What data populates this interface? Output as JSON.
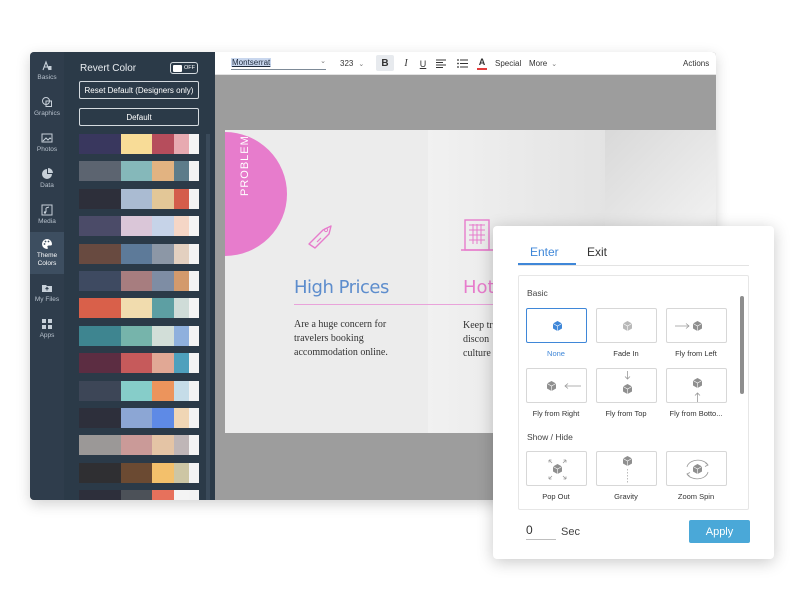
{
  "nav": {
    "items": [
      {
        "label": "Basics",
        "icon": "basics-icon"
      },
      {
        "label": "Graphics",
        "icon": "graphics-icon"
      },
      {
        "label": "Photos",
        "icon": "photos-icon"
      },
      {
        "label": "Data",
        "icon": "data-icon"
      },
      {
        "label": "Media",
        "icon": "media-icon"
      },
      {
        "label": "Theme Colors",
        "icon": "palette-icon"
      },
      {
        "label": "My Files",
        "icon": "folder-icon"
      },
      {
        "label": "Apps",
        "icon": "apps-icon"
      }
    ],
    "active": "Theme Colors"
  },
  "color_panel": {
    "revert_label": "Revert Color",
    "toggle_state": "OFF",
    "reset_label": "Reset Default (Designers only)",
    "default_label": "Default",
    "palettes": [
      [
        "#39375e",
        "#f8dc97",
        "#b64d5c",
        "#e7aab1",
        "#f4f4f4"
      ],
      [
        "#5c6470",
        "#85b8ba",
        "#e2b381",
        "#5d7c8a",
        "#f3f3f3"
      ],
      [
        "#2d2f3a",
        "#aabbd2",
        "#e3c797",
        "#d45d4b",
        "#f3f3f3"
      ],
      [
        "#4b4b68",
        "#dac6d8",
        "#c6d3e8",
        "#f5d6c6",
        "#f4f4f4"
      ],
      [
        "#684a40",
        "#5d7a99",
        "#8c97a6",
        "#e3d0c0",
        "#f3f3f3"
      ],
      [
        "#3e4a61",
        "#a77d7f",
        "#7e8da4",
        "#d39a6c",
        "#f3f3f3"
      ],
      [
        "#d9604a",
        "#f1dcae",
        "#5d9fa3",
        "#cfdcd8",
        "#f4f4f4"
      ],
      [
        "#3e8590",
        "#76b4ab",
        "#d2ded8",
        "#8fb0dd",
        "#f3f3f3"
      ],
      [
        "#5c2d42",
        "#c65a5b",
        "#e1a895",
        "#4ea0bd",
        "#f3f3f3"
      ],
      [
        "#3d4657",
        "#86cdc9",
        "#ec945c",
        "#c5dce8",
        "#f3f3f3"
      ],
      [
        "#2d2f3b",
        "#8ca6d4",
        "#5e8ae6",
        "#f0d6b5",
        "#f3f3f3"
      ],
      [
        "#9b9897",
        "#ca9a98",
        "#e4c4a5",
        "#bfb6b7",
        "#f3f3f3"
      ],
      [
        "#2f2f32",
        "#6b4a32",
        "#f3c06b",
        "#cdc6a4",
        "#f3f3f3"
      ],
      [
        "#2d2f3b",
        "#4c5158",
        "#e7715c",
        "#f4f4f4",
        "#f3f3f3"
      ]
    ]
  },
  "toolbar": {
    "font": "Montserrat",
    "size": "323",
    "bold": "B",
    "italic": "I",
    "underline": "U",
    "color_letter": "A",
    "special": "Special",
    "more": "More",
    "actions": "Actions"
  },
  "slide": {
    "section_label": "PROBLEM",
    "heading_1": "High Prices",
    "body_1": "Are a huge concern for travelers booking accommodation online.",
    "heading_2": "Hot",
    "body_2": "Keep tr\ndiscon\nculture"
  },
  "animation": {
    "tabs": [
      "Enter",
      "Exit"
    ],
    "active_tab": "Enter",
    "groups": [
      {
        "label": "Basic",
        "effects": [
          "None",
          "Fade In",
          "Fly from Left",
          "Fly from Right",
          "Fly from Top",
          "Fly from Botto..."
        ]
      },
      {
        "label": "Show / Hide",
        "effects": [
          "Pop Out",
          "Gravity",
          "Zoom Spin"
        ]
      }
    ],
    "selected_effect": "None",
    "duration_value": "0",
    "duration_unit": "Sec",
    "apply_label": "Apply",
    "accent_color": "#3f87d8",
    "apply_color": "#4aa8d8"
  }
}
